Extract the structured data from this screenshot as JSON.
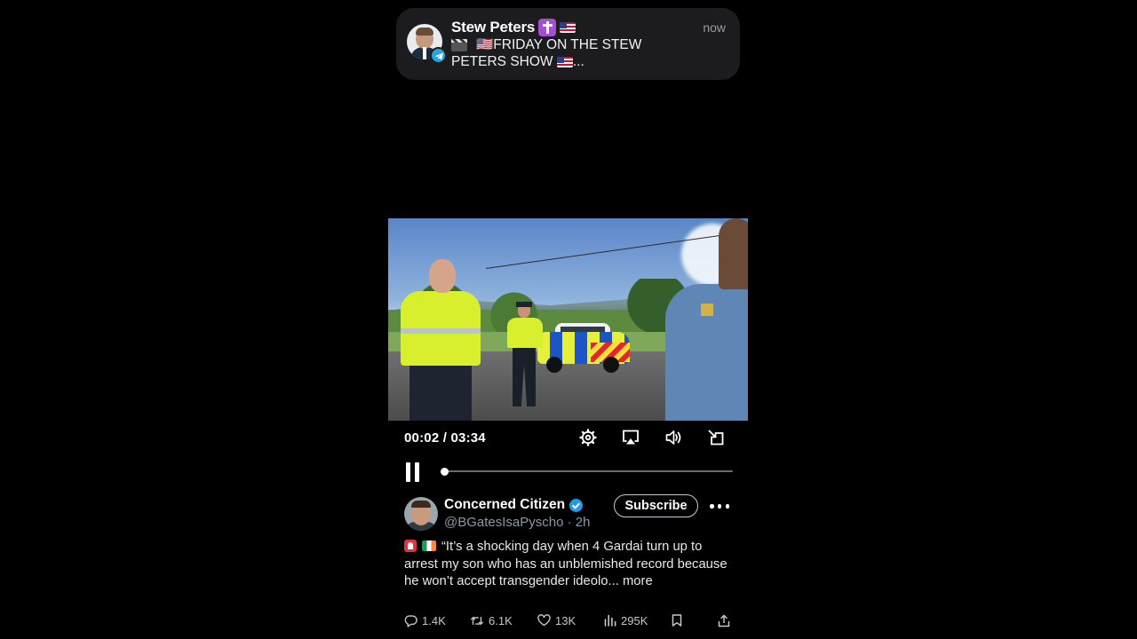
{
  "notification": {
    "sender": "Stew Peters",
    "time": "now",
    "body_line1": "🇺🇸FRIDAY ON THE STEW",
    "body_line2": "PETERS SHOW",
    "body_ellipsis": "...",
    "icons": [
      "avatar-stew-peters",
      "telegram-icon",
      "cross-emoji",
      "us-flag-emoji",
      "clapperboard-emoji"
    ]
  },
  "player": {
    "current_time": "00:02",
    "duration": "03:34",
    "separator": " / ",
    "progress_fraction": 0.0093,
    "controls": [
      "settings-gear-icon",
      "airplay-icon",
      "volume-icon",
      "exit-fullscreen-icon"
    ],
    "state": "playing"
  },
  "post": {
    "display_name": "Concerned Citizen",
    "handle": "@BGatesIsaPyscho",
    "separator": " · ",
    "age": "2h",
    "subscribe_label": "Subscribe",
    "text": "“It’s a shocking day when 4 Gardai turn up to arrest my son who has an unblemished record because he won’t accept transgender ideolo",
    "ellipsis": "...",
    "more_label": " more",
    "emoji": [
      "siren-emoji",
      "ireland-flag-emoji"
    ]
  },
  "actions": {
    "replies": "1.4K",
    "reposts": "6.1K",
    "likes": "13K",
    "views": "295K"
  },
  "colors": {
    "background": "#000000",
    "notification_bg": "#1c1c1e",
    "verified_blue": "#1d9bf0",
    "muted_text": "#8b98a5"
  }
}
